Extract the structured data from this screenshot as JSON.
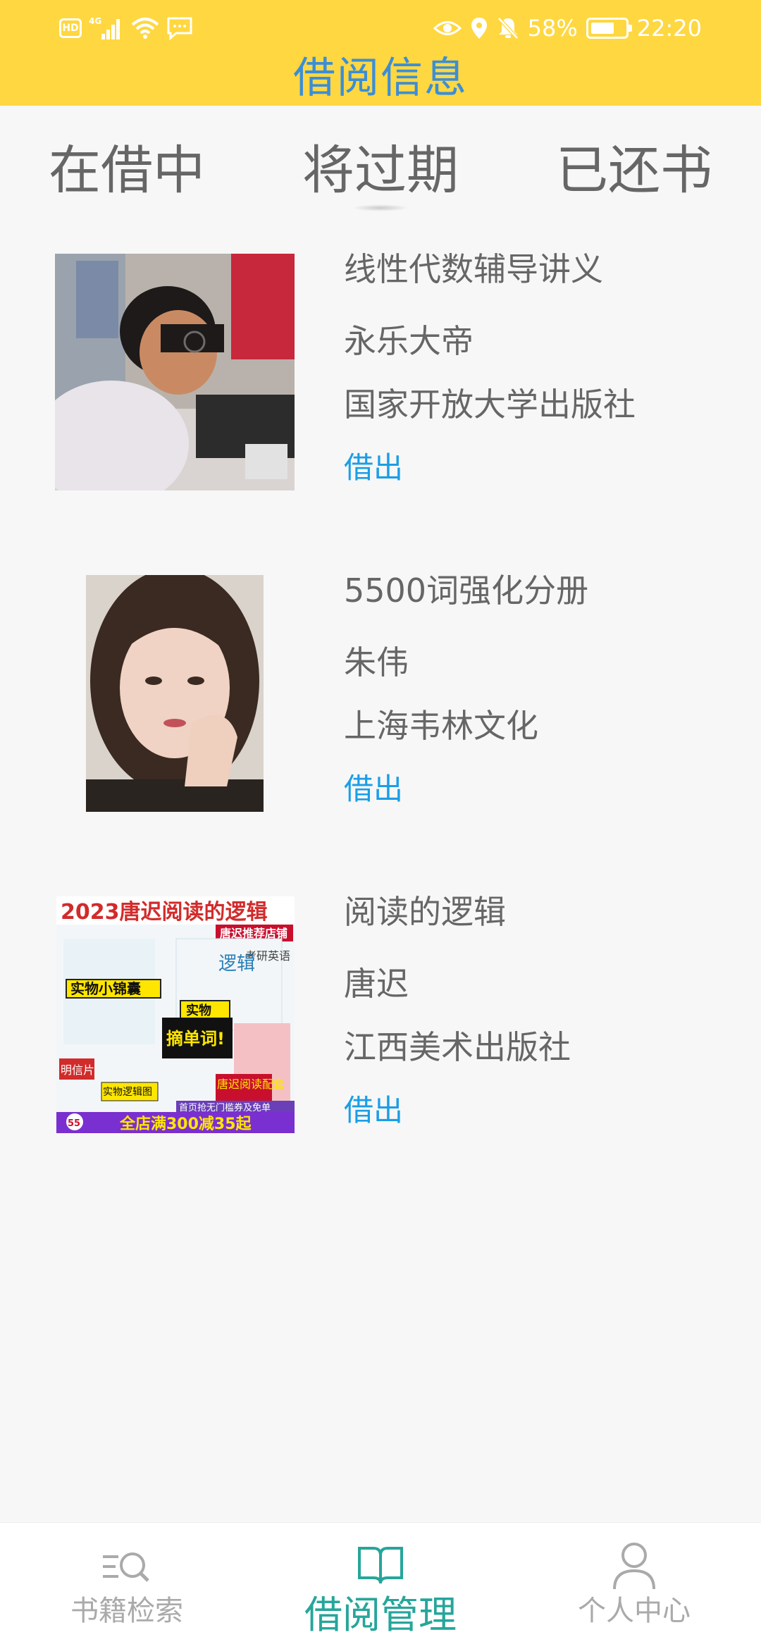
{
  "status_bar": {
    "hd_label": "HD",
    "network_label": "4G",
    "battery_percent": "58%",
    "time": "22:20",
    "icons": [
      "signal-icon",
      "wifi-icon",
      "message-icon",
      "eye-icon",
      "location-icon",
      "mute-icon",
      "battery-icon"
    ]
  },
  "header": {
    "title": "借阅信息",
    "background": "#ffd740",
    "title_color": "#3b8ed6"
  },
  "tabs": [
    {
      "label": "在借中"
    },
    {
      "label": "将过期"
    },
    {
      "label": "已还书"
    }
  ],
  "books": [
    {
      "title": "线性代数辅导讲义",
      "author": "永乐大帝",
      "publisher": "国家开放大学出版社",
      "action": "借出",
      "cover": "photo-man-cover"
    },
    {
      "title": "5500词强化分册",
      "author": "朱伟",
      "publisher": "上海韦林文化",
      "action": "借出",
      "cover": "photo-woman-cover"
    },
    {
      "title": "阅读的逻辑",
      "author": "唐迟",
      "publisher": "江西美术出版社",
      "action": "借出",
      "cover": "product-ad-cover",
      "cover_text": {
        "headline": "2023唐迟阅读的逻辑",
        "store": "唐迟推荐店铺",
        "book_title": "逻辑",
        "book_subtitle": "考研英语",
        "sticker_1": "实物小锦囊",
        "sticker_2": "实物",
        "sticker_3": "摘单词!",
        "card": "明信片",
        "map": "实物逻辑图",
        "promo_1": "首页抢无门槛券及免单",
        "promo_2": "全店满300减35起",
        "promo_3": "唐迟阅读配套",
        "small_badge": "55"
      }
    }
  ],
  "bottom_nav": [
    {
      "label": "书籍检索",
      "icon": "search-list-icon"
    },
    {
      "label": "借阅管理",
      "icon": "book-icon"
    },
    {
      "label": "个人中心",
      "icon": "person-icon"
    }
  ],
  "colors": {
    "accent": "#26a69a",
    "link": "#1a9ee6",
    "text": "#666666",
    "nav_inactive": "#aaaaaa"
  }
}
